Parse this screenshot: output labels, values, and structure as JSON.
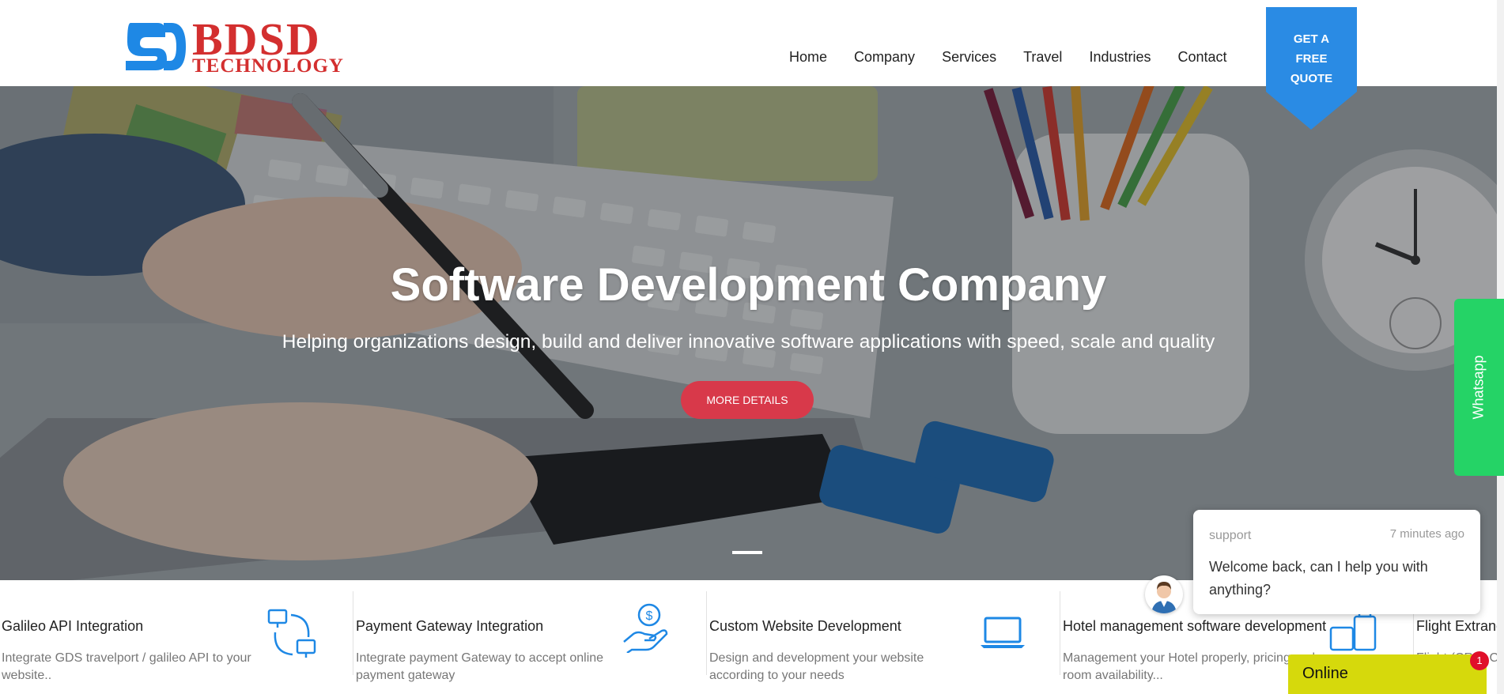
{
  "brand": {
    "name": "BDSD",
    "sub": "TECHNOLOGY",
    "colors": {
      "red": "#d32f2f",
      "blue": "#1e88e5"
    }
  },
  "nav": {
    "items": [
      {
        "label": "Home"
      },
      {
        "label": "Company"
      },
      {
        "label": "Services"
      },
      {
        "label": "Travel"
      },
      {
        "label": "Industries"
      },
      {
        "label": "Contact"
      }
    ]
  },
  "quote_button": {
    "label": "GET A\nFREE\nQUOTE",
    "color": "#2a8be4"
  },
  "hero": {
    "title": "Software Development Company",
    "subtitle": "Helping organizations design, build and deliver innovative software applications with speed, scale and quality",
    "button": "MORE DETAILS",
    "button_color": "#d8394a"
  },
  "whatsapp": {
    "label": "Whatsapp",
    "color": "#25d366"
  },
  "services": [
    {
      "title": "Galileo API Integration",
      "desc": "Integrate GDS travelport / galileo API to your website..",
      "icon": "sync-computers-icon"
    },
    {
      "title": "Payment Gateway Integration",
      "desc": "Integrate payment Gateway to accept online payment gateway",
      "icon": "hand-coin-icon"
    },
    {
      "title": "Custom Website Development",
      "desc": "Design and development your website according to your needs",
      "icon": "laptop-icon"
    },
    {
      "title": "Hotel management software development",
      "desc": "Management your Hotel properly, pricing and room availability...",
      "icon": "luggage-icon"
    },
    {
      "title": "Flight Extranet",
      "desc": "Flight (CRS) Ce fa",
      "icon": "plane-icon"
    }
  ],
  "chat": {
    "from": "support",
    "time": "7 minutes ago",
    "message": "Welcome back, can I help you with anything?",
    "status": "Online",
    "badge": "1",
    "status_color": "#d6d90c"
  }
}
